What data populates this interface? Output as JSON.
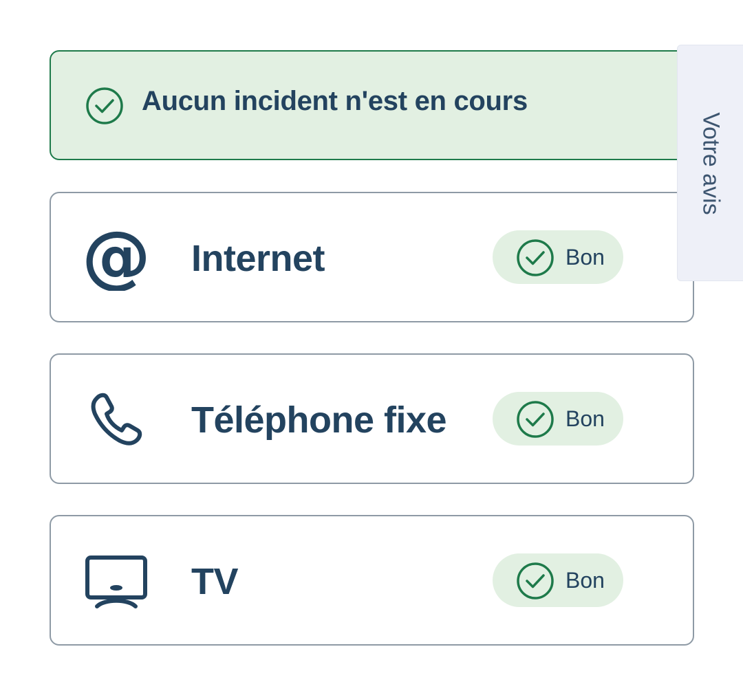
{
  "banner": {
    "text": "Aucun incident n'est en cours",
    "icon": "check-circle-icon",
    "background_color": "#e2f0e2",
    "border_color": "#1e7a4a"
  },
  "services": [
    {
      "label": "Internet",
      "icon": "at-sign-icon",
      "status": "Bon"
    },
    {
      "label": "Téléphone fixe",
      "icon": "phone-icon",
      "status": "Bon"
    },
    {
      "label": "TV",
      "icon": "tv-icon",
      "status": "Bon"
    }
  ],
  "feedback_tab": {
    "label": "Votre avis"
  },
  "colors": {
    "text": "#23435f",
    "success": "#1e7a4a",
    "success_bg": "#e2f0e2",
    "card_border": "#8e9aa5",
    "feedback_bg": "#eef0f8"
  }
}
